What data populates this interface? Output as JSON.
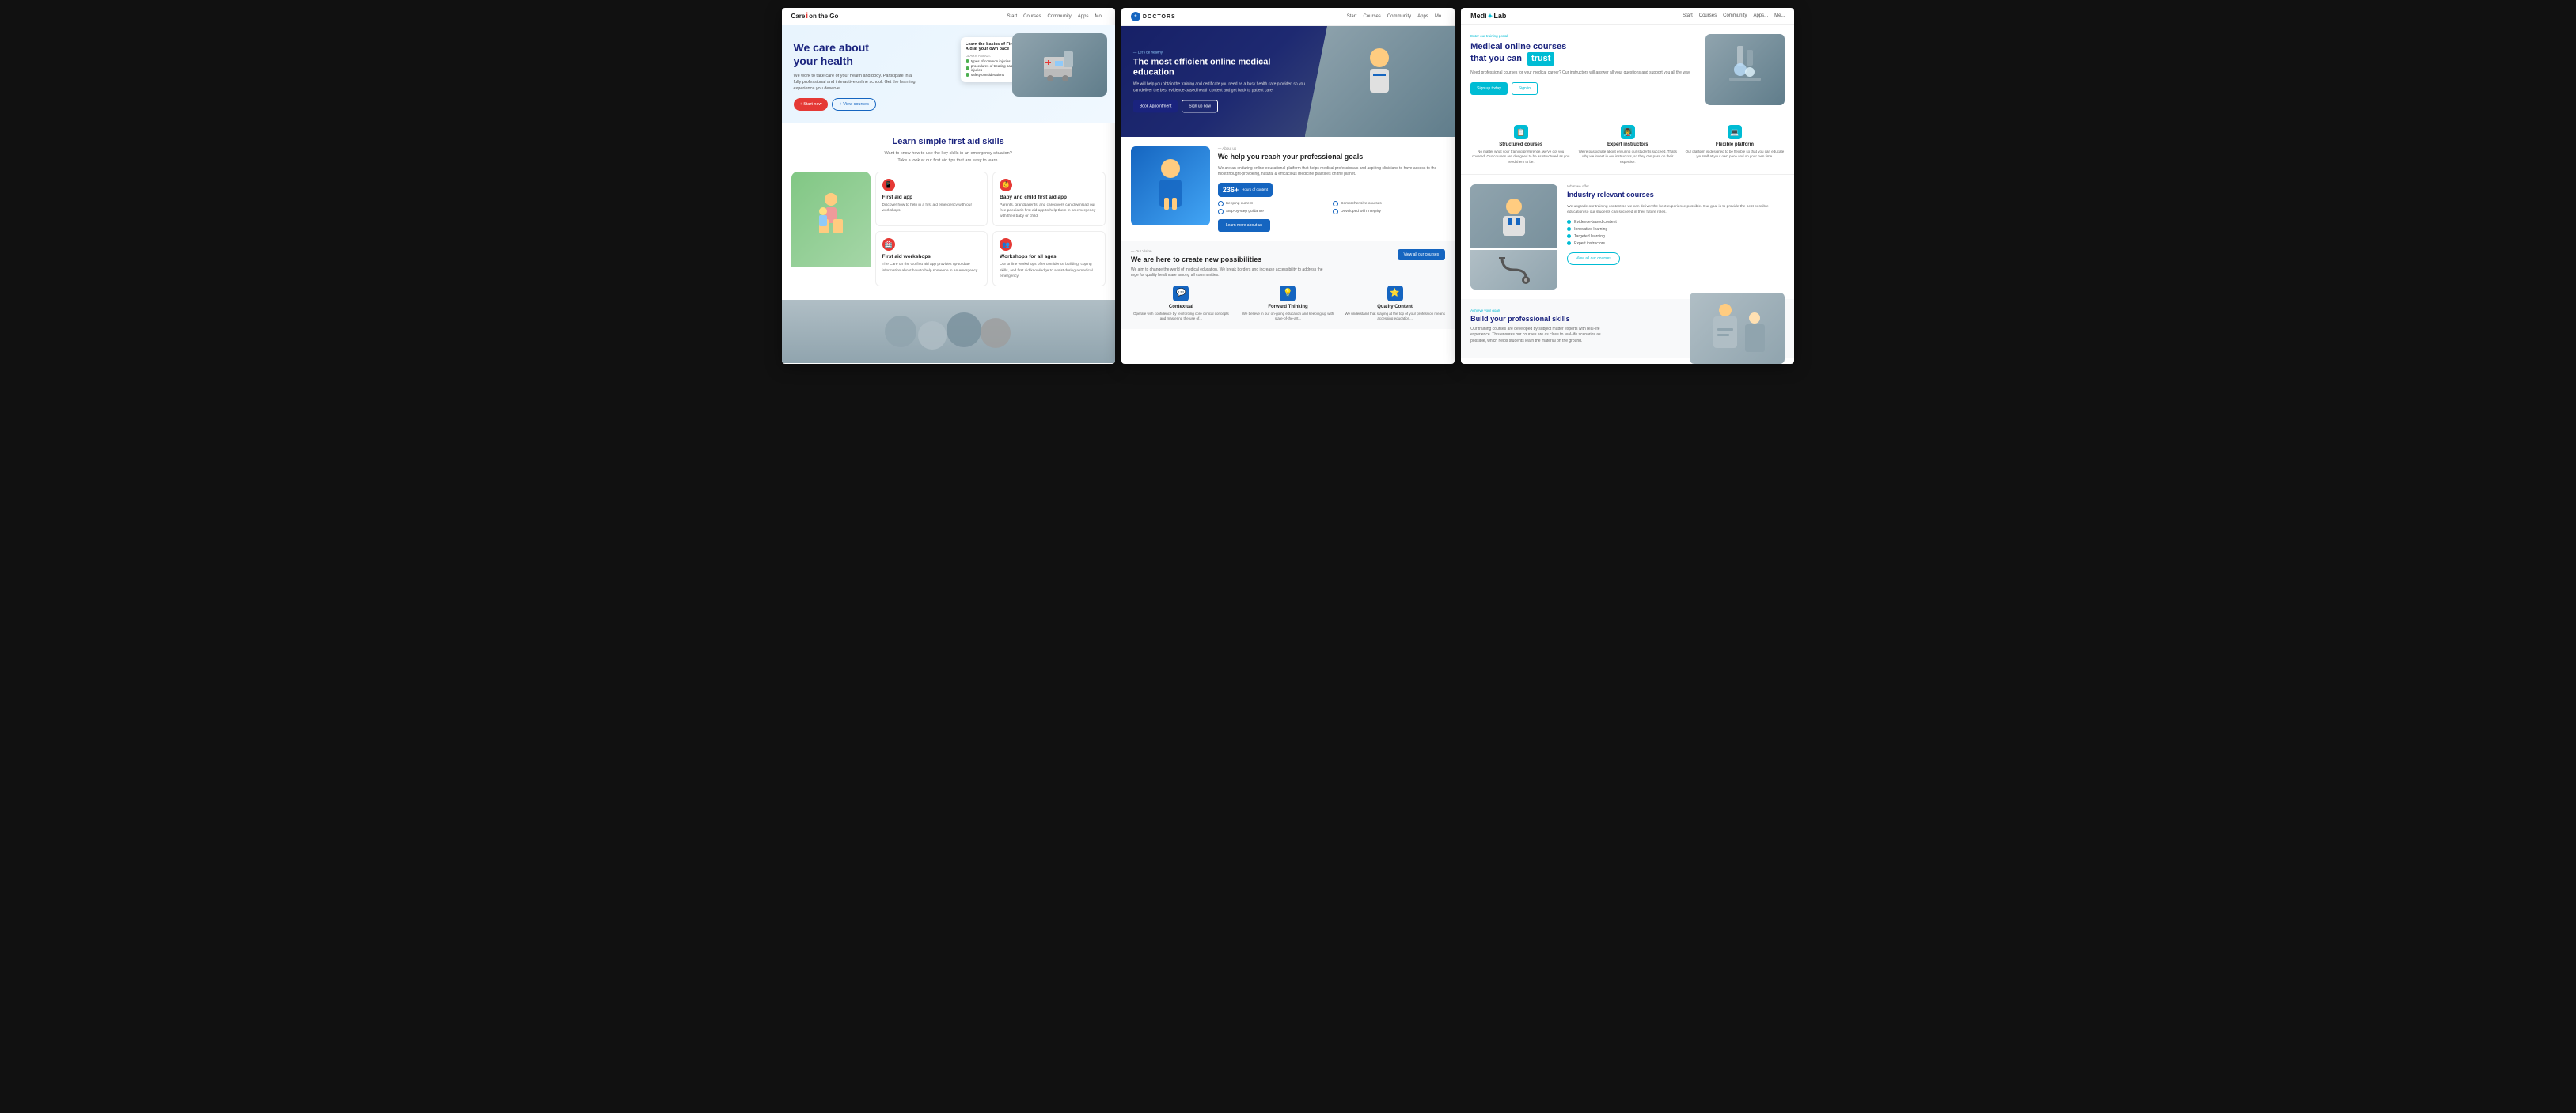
{
  "page1": {
    "logo": "Care",
    "logo_highlight": "i",
    "logo_suffix": "on the Go",
    "nav_links": [
      "Start",
      "Courses",
      "Community",
      "Apps",
      "Mo..."
    ],
    "hero": {
      "title_line1": "We care about",
      "title_line2": "your health",
      "description": "We work to take care of your health and body. Participate in a fully professional and interactive online school. Get the learning experience you deserve.",
      "btn_start": "+ Start now",
      "btn_courses": "+ View courses",
      "card_title": "Learn the basics of First Aid at your own pace",
      "card_learn_about": "LEARN ABOUT:",
      "card_items": [
        "types of common injuries",
        "procedures of treating basic injuries",
        "safety considerations"
      ]
    },
    "section2": {
      "title": "Learn simple first aid skills",
      "subtitle_line1": "Want to know how to use the key skills in an emergency situation?",
      "subtitle_line2": "Take a look at our first aid tips that are easy to learn."
    },
    "cards": [
      {
        "icon": "📱",
        "title": "First aid app",
        "description": "Discover how to help in a first aid emergency with our workshops."
      },
      {
        "icon": "👶",
        "title": "Baby and child first aid app",
        "description": "Parents, grandparents, and caregivers can download our free paediatric first aid app to help them in an emergency with their baby or child."
      },
      {
        "icon": "🏥",
        "title": "First aid workshops",
        "description": "The Care on the Go first aid app provides up-to-date information about how to help someone in an emergency."
      },
      {
        "icon": "👥",
        "title": "Workshops for all ages",
        "description": "Our online workshops offer confidence building, coping skills, and first aid knowledge to assist during a medical emergency."
      }
    ]
  },
  "page2": {
    "logo": "DOCTORS",
    "nav_links": [
      "Start",
      "Courses",
      "Community",
      "Apps",
      "Mo..."
    ],
    "hero": {
      "tag": "— Let's be healthy",
      "title": "The most efficient online medical education",
      "description": "We will help you obtain the training and certificate you need as a busy health care provider, so you can deliver the best evidence-based health content and get back to patient care.",
      "btn_book": "Book Appointment",
      "btn_signup": "Sign up now"
    },
    "about": {
      "tag": "— About us",
      "title": "We help you reach your professional goals",
      "description": "We are an enduring online educational platform that helps medical professionals and aspiring clinicians to have access to the most thought-provoking, natural & efficacious medicine practices on the planet.",
      "features": [
        "Keeping current",
        "Comprehensive courses",
        "Step-by-step guidance",
        "Developed with integrity"
      ],
      "stat_num": "236+",
      "stat_label": "Hours of content",
      "btn_learn": "Learn more about us"
    },
    "vision": {
      "tag": "— Our Vision",
      "title": "We are here to create new possibilities",
      "description": "We aim to change the world of medical education. We break borders and increase accessibility to address the urge for quality healthcare among all communities.",
      "btn_courses": "View all our courses",
      "cards": [
        {
          "icon": "💬",
          "title": "Contextual",
          "description": "Operate with confidence by reinforcing core clinical concepts and mastering the use of..."
        },
        {
          "icon": "💡",
          "title": "Forward Thinking",
          "description": "We believe in our on-going education and keeping up with state-of-the-art..."
        },
        {
          "icon": "⭐",
          "title": "Quality Content",
          "description": "We understand that staying at the top of your profession means accessing education..."
        }
      ]
    }
  },
  "page3": {
    "logo_prefix": "Medi",
    "logo_star": "✦",
    "logo_suffix": "Lab",
    "nav_links": [
      "Start",
      "Courses",
      "Community",
      "Apps...",
      "Me..."
    ],
    "hero": {
      "tag": "Enter our training portal",
      "title_line1": "Medical online courses",
      "title_line2": "that you can",
      "title_highlight": "trust",
      "description": "Need professional courses for your medical career? Our instructors will answer all your questions and support you all the way.",
      "btn_signup": "Sign up today",
      "btn_signin": "Sign in"
    },
    "features": [
      {
        "icon": "📋",
        "title": "Structured courses",
        "description": "No matter what your training preference, we've got you covered. Our courses are designed to be as structured as you need them to be."
      },
      {
        "icon": "👨‍🏫",
        "title": "Expert instructors",
        "description": "We're passionate about ensuring our students succeed. That's why we invest in our instructors, so they can pass on their expertise."
      },
      {
        "icon": "💻",
        "title": "Flexible platform",
        "description": "Our platform is designed to be flexible so that you can educate yourself at your own pace and on your own time."
      }
    ],
    "courses": {
      "tag": "What we offer",
      "title": "Industry relevant courses",
      "description": "We upgrade our training content so we can deliver the best experience possible. Our goal is to provide the best possible education so our students can succeed in their future roles.",
      "features": [
        "Evidence-based content",
        "Innovative learning",
        "Targeted learning",
        "Expert instructors"
      ],
      "btn_view": "View all our courses"
    },
    "skills": {
      "tag": "Achieve your goals",
      "title": "Build your professional skills",
      "description": "Our training courses are developed by subject matter experts with real-life experience. This ensures our courses are as close to real-life scenarios as possible, which helps students learn the material on the ground."
    }
  }
}
